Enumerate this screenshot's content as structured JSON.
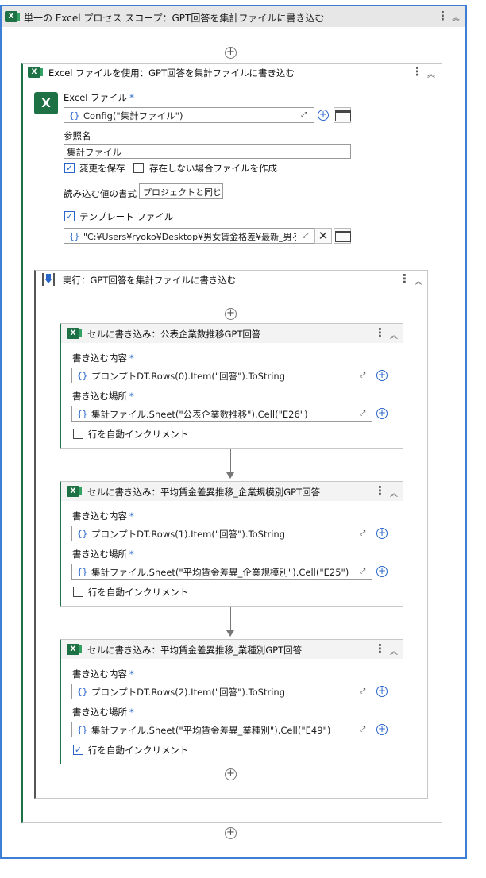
{
  "scope": {
    "title": "単一の Excel プロセス スコープ：GPT回答を集計ファイルに書き込む"
  },
  "use_excel": {
    "title": "Excel ファイルを使用：GPT回答を集計ファイルに書き込む",
    "file_label": "Excel ファイル",
    "file_value": "Config(\"集計ファイル\")",
    "ref_label": "参照名",
    "ref_value": "集計ファイル",
    "save_changes": "変更を保存",
    "create_if_missing": "存在しない場合ファイルを作成",
    "read_format_label": "読み込む値の書式",
    "read_format_value": "プロジェクトと同じ",
    "template_label": "テンプレート ファイル",
    "template_value": "\"C:¥Users¥ryoko¥Desktop¥男女賃金格差¥最新_男ろ"
  },
  "sequence": {
    "title": "実行：GPT回答を集計ファイルに書き込む"
  },
  "cards": [
    {
      "title": "セルに書き込み：公表企業数推移GPT回答",
      "content_label": "書き込む内容",
      "content_value": "プロンプトDT.Rows(0).Item(\"回答\").ToString",
      "location_label": "書き込む場所",
      "location_value": "集計ファイル.Sheet(\"公表企業数推移\").Cell(\"E26\")",
      "autoinc_label": "行を自動インクリメント"
    },
    {
      "title": "セルに書き込み：平均賃金差異推移_企業規模別GPT回答",
      "content_label": "書き込む内容",
      "content_value": "プロンプトDT.Rows(1).Item(\"回答\").ToString",
      "location_label": "書き込む場所",
      "location_value": "集計ファイル.Sheet(\"平均賃金差異_企業規模別\").Cell(\"E25\")",
      "autoinc_label": "行を自動インクリメント"
    },
    {
      "title": "セルに書き込み：平均賃金差異推移_業種別GPT回答",
      "content_label": "書き込む内容",
      "content_value": "プロンプトDT.Rows(2).Item(\"回答\").ToString",
      "location_label": "書き込む場所",
      "location_value": "集計ファイル.Sheet(\"平均賃金差異_業種別\").Cell(\"E49\")",
      "autoinc_label": "行を自動インクリメント"
    }
  ],
  "symbols": {
    "required": "*",
    "braces": "{}",
    "kebab": "⋮",
    "collapse": "︽",
    "plus": "+",
    "check": "✓",
    "chevron_down": "⌄",
    "expand": "⤢",
    "clear": "✕"
  },
  "colors": {
    "accent_blue": "#3d7fd6",
    "excel_green": "#1e7145",
    "required_blue": "#1f63c7"
  },
  "icons": [
    "excel-icon",
    "kebab-menu-icon",
    "collapse-icon",
    "add-activity-icon",
    "expand-editor-icon",
    "plus-circle-icon",
    "folder-icon",
    "clear-icon",
    "sequence-icon",
    "check-icon",
    "chevron-down-icon",
    "arrow-down-icon"
  ]
}
